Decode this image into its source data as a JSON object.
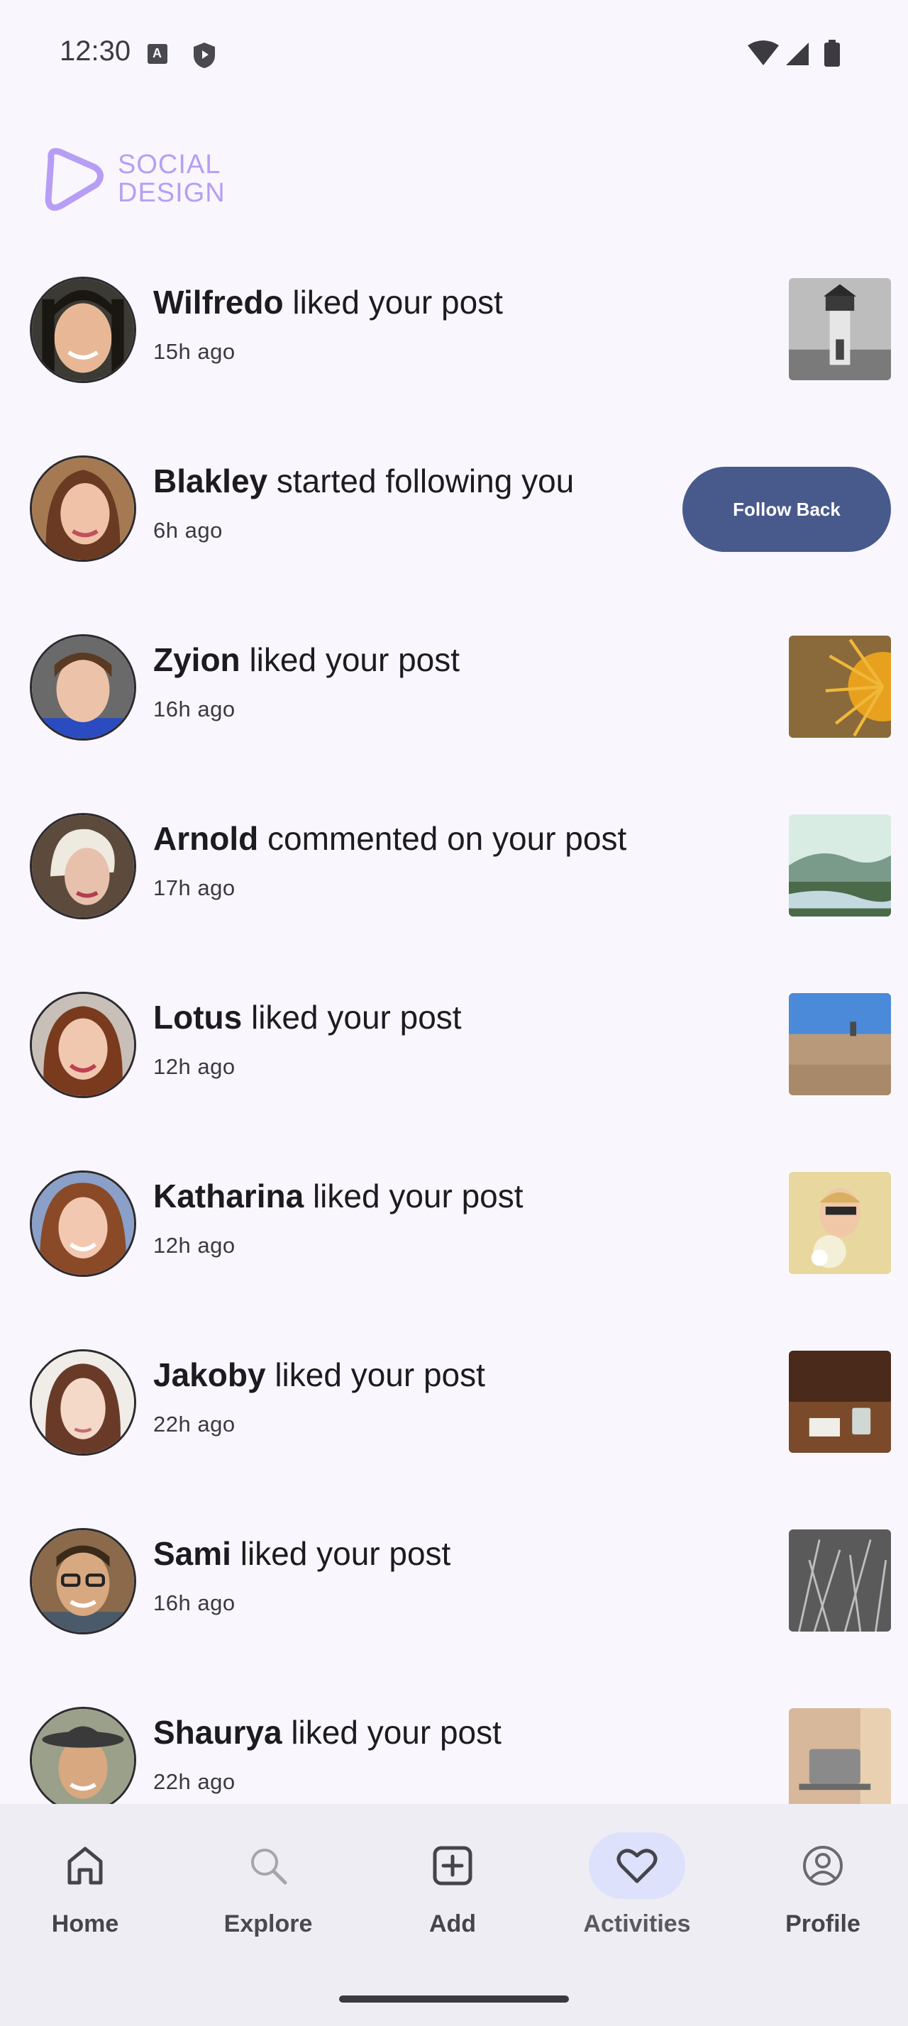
{
  "status_bar": {
    "time": "12:30",
    "icons": [
      "keyboard-a-icon",
      "shield-icon",
      "wifi-icon",
      "signal-icon",
      "battery-icon"
    ]
  },
  "logo": {
    "line1": "SOCIAL",
    "line2": "DESIGN",
    "color": "#b79ef5"
  },
  "feed": [
    {
      "name": "Wilfredo",
      "action": "liked your post",
      "time": "15h ago",
      "trailing": "thumbnail",
      "thumb": "lighthouse-photo"
    },
    {
      "name": "Blakley",
      "action": "started following you",
      "time": "6h ago",
      "trailing": "follow-button"
    },
    {
      "name": "Zyion",
      "action": "liked your post",
      "time": "16h ago",
      "trailing": "thumbnail",
      "thumb": "orange-plant-photo"
    },
    {
      "name": "Arnold",
      "action": "commented on your post",
      "time": "17h ago",
      "trailing": "thumbnail",
      "thumb": "river-valley-photo"
    },
    {
      "name": "Lotus",
      "action": "liked your post",
      "time": "12h ago",
      "trailing": "thumbnail",
      "thumb": "beach-photo"
    },
    {
      "name": "Katharina",
      "action": "liked your post",
      "time": "12h ago",
      "trailing": "thumbnail",
      "thumb": "woman-sunglasses-photo"
    },
    {
      "name": "Jakoby",
      "action": "liked your post",
      "time": "22h ago",
      "trailing": "thumbnail",
      "thumb": "desk-glass-photo"
    },
    {
      "name": "Sami",
      "action": "liked your post",
      "time": "16h ago",
      "trailing": "thumbnail",
      "thumb": "grass-bw-photo"
    },
    {
      "name": "Shaurya",
      "action": "liked your post",
      "time": "22h ago",
      "trailing": "thumbnail",
      "thumb": "laptop-photo"
    }
  ],
  "follow_back_label": "Follow Back",
  "nav": {
    "items": [
      {
        "label": "Home",
        "icon": "home-icon",
        "active": false
      },
      {
        "label": "Explore",
        "icon": "search-icon",
        "active": false
      },
      {
        "label": "Add",
        "icon": "add-box-icon",
        "active": false
      },
      {
        "label": "Activities",
        "icon": "heart-icon",
        "active": true
      },
      {
        "label": "Profile",
        "icon": "profile-icon",
        "active": false
      }
    ]
  },
  "colors": {
    "background": "#f9f7fd",
    "accent_button": "#48598c",
    "nav_active_pill": "#dde1fb",
    "nav_background": "#efedf4"
  }
}
